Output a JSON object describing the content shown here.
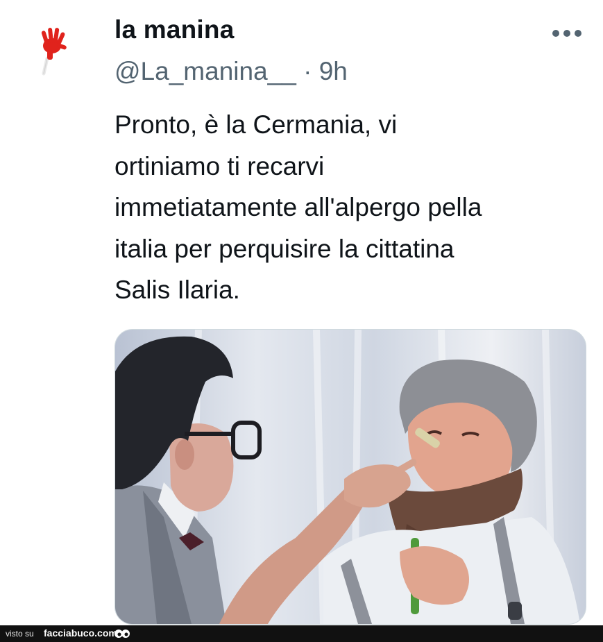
{
  "tweet": {
    "display_name": "la manina",
    "handle": "@La_manina__",
    "separator": "·",
    "time": "9h",
    "avatar_icon": "red-hand-clapper-icon",
    "more_icon": "more-options-icon",
    "text_lines": [
      "Pronto, è la Cermania, vi",
      "ortiniamo ti recarvi",
      "immetiatamente all'alpergo pella",
      "italia per perquisire la cittatina",
      "Salis Ilaria."
    ],
    "media": {
      "kind": "photo",
      "icon": "movie-still-photo"
    }
  },
  "footer": {
    "prefix": "visto su",
    "site": "facciabuco.com",
    "logo_icon": "facciabuco-eyes-icon"
  },
  "colors": {
    "text": "#0f1419",
    "secondary_text": "#536471",
    "footer_bg": "#111111",
    "avatar_hand": "#e0231c"
  }
}
